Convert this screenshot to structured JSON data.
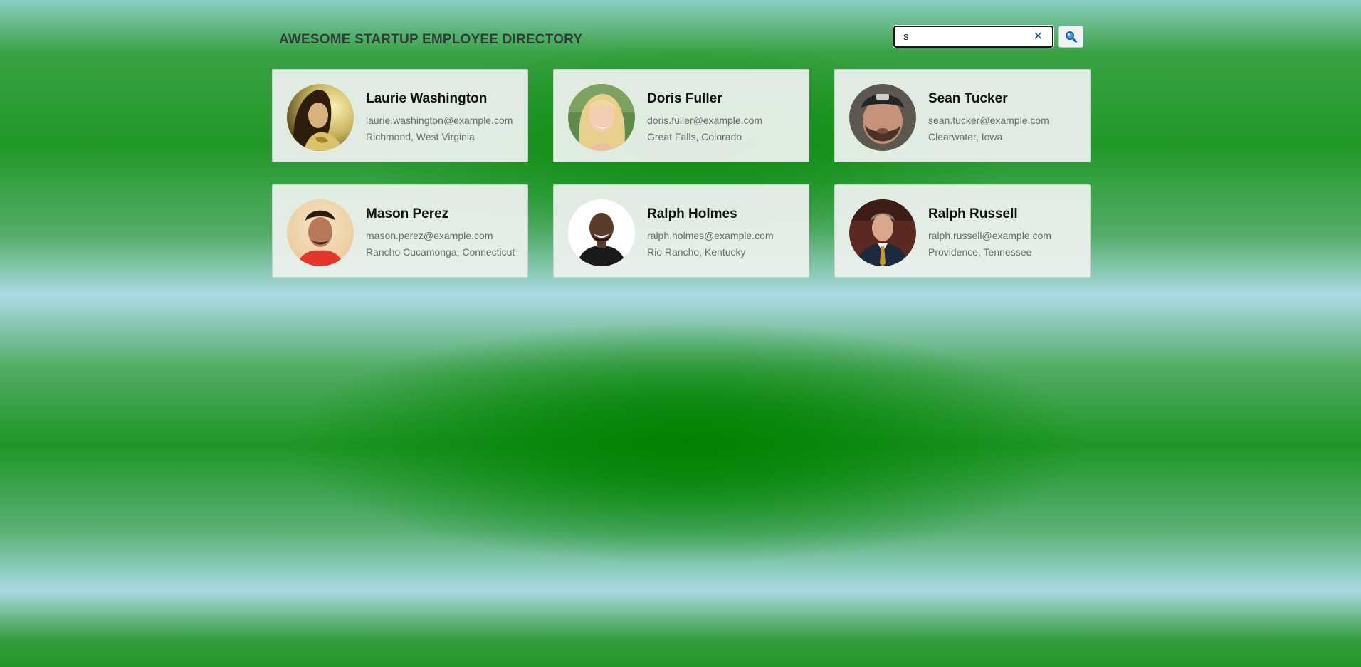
{
  "header": {
    "title": "AWESOME STARTUP EMPLOYEE DIRECTORY"
  },
  "search": {
    "value": "s",
    "clear_icon": "close-icon",
    "button_icon": "search-icon"
  },
  "employees": [
    {
      "name": "Laurie Washington",
      "email": "laurie.washington@example.com",
      "location": "Richmond, West Virginia"
    },
    {
      "name": "Doris Fuller",
      "email": "doris.fuller@example.com",
      "location": "Great Falls, Colorado"
    },
    {
      "name": "Sean Tucker",
      "email": "sean.tucker@example.com",
      "location": "Clearwater, Iowa"
    },
    {
      "name": "Mason Perez",
      "email": "mason.perez@example.com",
      "location": "Rancho Cucamonga, Connecticut"
    },
    {
      "name": "Ralph Holmes",
      "email": "ralph.holmes@example.com",
      "location": "Rio Rancho, Kentucky"
    },
    {
      "name": "Ralph Russell",
      "email": "ralph.russell@example.com",
      "location": "Providence, Tennessee"
    }
  ]
}
